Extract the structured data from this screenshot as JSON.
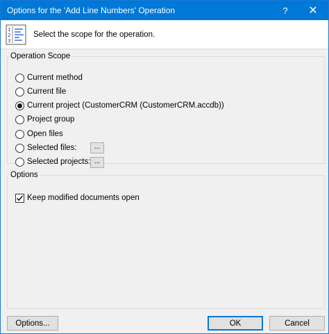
{
  "window": {
    "title": "Options for the 'Add Line Numbers' Operation",
    "help_glyph": "?",
    "close_glyph": "✕"
  },
  "header": {
    "icon": "line-numbers-icon",
    "text": "Select the scope for the operation."
  },
  "scope": {
    "legend": "Operation Scope",
    "items": [
      {
        "label": "Current method",
        "checked": false
      },
      {
        "label": "Current file",
        "checked": false
      },
      {
        "label": "Current project (CustomerCRM (CustomerCRM.accdb))",
        "checked": true
      },
      {
        "label": "Project group",
        "checked": false
      },
      {
        "label": "Open files",
        "checked": false
      },
      {
        "label": "Selected files:",
        "checked": false
      },
      {
        "label": "Selected projects:",
        "checked": false
      }
    ],
    "browse_label": "..."
  },
  "options": {
    "legend": "Options",
    "keep_open_label": "Keep modified documents open",
    "keep_open_checked": true
  },
  "buttons": {
    "options": "Options...",
    "ok": "OK",
    "cancel": "Cancel"
  },
  "colors": {
    "titlebar": "#0078d7",
    "dialog_bg": "#f0f0f0"
  }
}
